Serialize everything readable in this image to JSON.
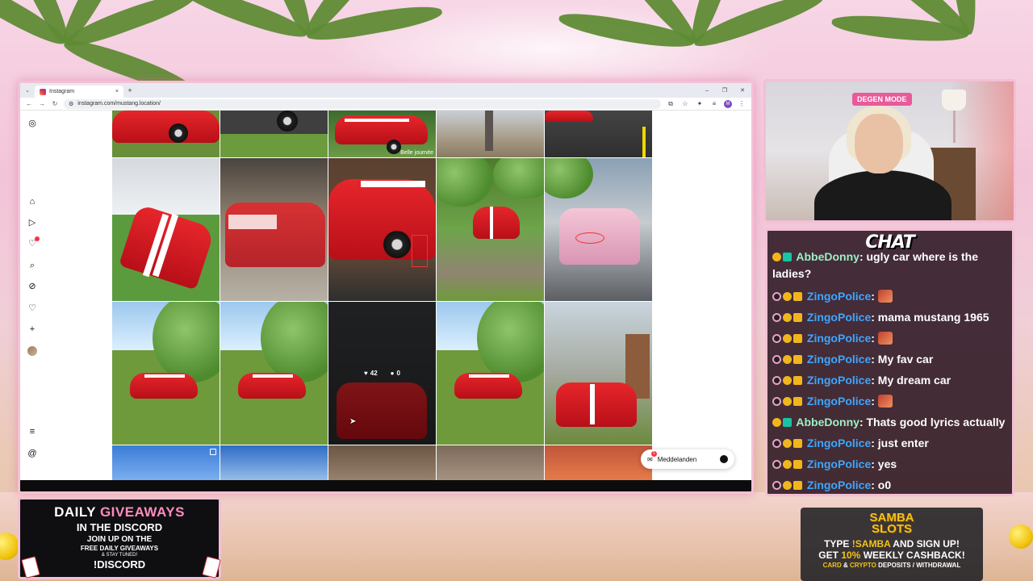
{
  "browser": {
    "tab_title": "Instagram",
    "url": "instagram.com/mustang.location/",
    "new_tab": "+",
    "close_tab": "×"
  },
  "instagram": {
    "sidebar_icons": [
      "instagram-logo-icon",
      "home-icon",
      "reels-icon",
      "notifications-icon",
      "search-icon",
      "explore-icon",
      "likes-icon",
      "create-icon",
      "profile-avatar",
      "menu-icon",
      "threads-icon"
    ],
    "hover_stats": {
      "likes": "42",
      "comments": "0"
    },
    "watermark_text": "Belle journée",
    "messages_label": "Meddelanden",
    "messages_badge": "1"
  },
  "webcam": {
    "badge": "DEGEN MODE"
  },
  "chat": {
    "title": "CHAT",
    "messages": [
      {
        "user": "AbbeDonny",
        "text": ": ugly car where is the ladies?",
        "emote": false
      },
      {
        "user": "ZingoPolice",
        "text": ":",
        "emote": true
      },
      {
        "user": "ZingoPolice",
        "text": ": mama mustang 1965",
        "emote": false
      },
      {
        "user": "ZingoPolice",
        "text": ":",
        "emote": true
      },
      {
        "user": "ZingoPolice",
        "text": ": My fav car",
        "emote": false
      },
      {
        "user": "ZingoPolice",
        "text": ": My dream car",
        "emote": false
      },
      {
        "user": "ZingoPolice",
        "text": ":",
        "emote": true
      },
      {
        "user": "AbbeDonny",
        "text": ": Thats good lyrics actually",
        "emote": false
      },
      {
        "user": "ZingoPolice",
        "text": ": just enter",
        "emote": false
      },
      {
        "user": "ZingoPolice",
        "text": ": yes",
        "emote": false
      },
      {
        "user": "ZingoPolice",
        "text": ": o0",
        "emote": false
      }
    ]
  },
  "giveaway": {
    "line1_a": "DAILY",
    "line1_b": "GIVEAWAYS",
    "line2": "IN THE DISCORD",
    "line3": "JOIN UP ON THE",
    "line4": "FREE DAILY GIVEAWAYS",
    "line5": "& STAY TUNED!",
    "line6": "!DISCORD"
  },
  "samba": {
    "logo_1": "SAMBA",
    "logo_2": "SLOTS",
    "l1_a": "TYPE",
    "l1_b": "!SAMBA",
    "l1_c": "AND SIGN UP!",
    "l2_a": "GET",
    "l2_b": "10%",
    "l2_c": "WEEKLY CASHBACK!",
    "l3_a": "CARD",
    "l3_b": "&",
    "l3_c": "CRYPTO",
    "l3_d": "DEPOSITS / WITHDRAWAL"
  }
}
